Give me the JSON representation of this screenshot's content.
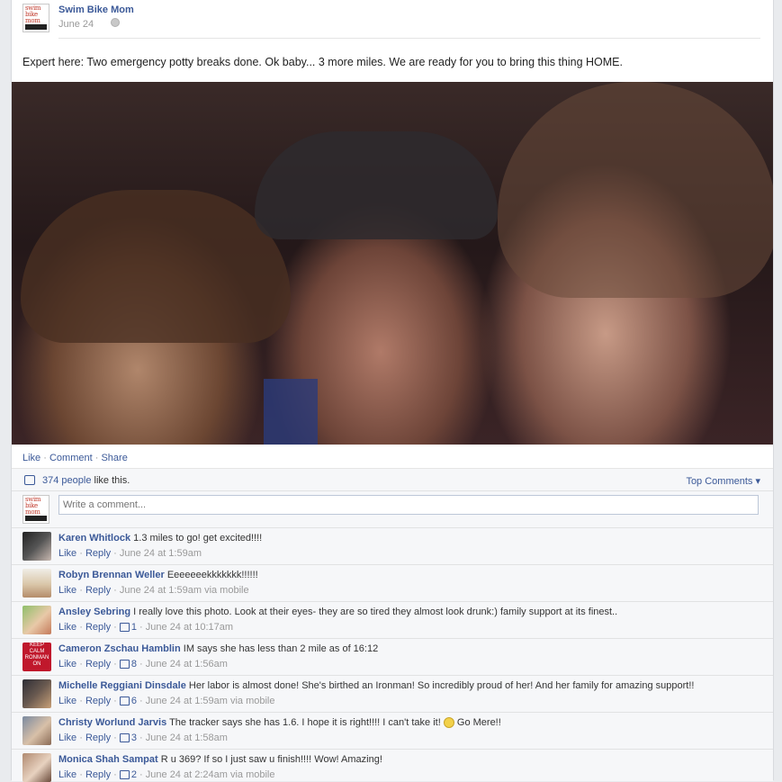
{
  "post": {
    "author": "Swim Bike Mom",
    "date": "June 24",
    "message": "Expert here: Two emergency potty breaks done. Ok baby... 3 more miles. We are ready for you to bring this thing HOME.",
    "logo_text": "swim bike mom"
  },
  "actions": {
    "like": "Like",
    "comment": "Comment",
    "share": "Share",
    "sep": "·"
  },
  "likes": {
    "count_text": "374 people",
    "suffix": " like this.",
    "top_comments": "Top Comments ▾"
  },
  "composer": {
    "placeholder": "Write a comment..."
  },
  "comments": [
    {
      "name": "Karen Whitlock",
      "text": "1.3 miles to go! get excited!!!!",
      "likes": "",
      "time": "June 24 at 1:59am",
      "via": ""
    },
    {
      "name": "Robyn Brennan Weller",
      "text": "Eeeeeeekkkkkkk!!!!!!",
      "likes": "",
      "time": "June 24 at 1:59am",
      "via": "via mobile"
    },
    {
      "name": "Ansley Sebring",
      "text": "I really love this photo. Look at their eyes- they are so tired they almost look drunk:) family support at its finest..",
      "likes": "1",
      "time": "June 24 at 10:17am",
      "via": ""
    },
    {
      "name": "Cameron Zschau Hamblin",
      "text": "IM says she has less than 2 mile as of 16:12",
      "likes": "8",
      "time": "June 24 at 1:56am",
      "via": ""
    },
    {
      "name": "Michelle Reggiani Dinsdale",
      "text": "Her labor is almost done! She's birthed an Ironman! So incredibly proud of her! And her family for amazing support!!",
      "likes": "6",
      "time": "June 24 at 1:59am",
      "via": "via mobile"
    },
    {
      "name": "Christy Worlund Jarvis",
      "text": "The tracker says she has 1.6. I hope it is right!!!! I can't take it!",
      "text2": "Go Mere!!",
      "likes": "3",
      "time": "June 24 at 1:58am",
      "via": ""
    },
    {
      "name": "Monica Shah Sampat",
      "text": "R u 369? If so I just saw u finish!!!! Wow! Amazing!",
      "likes": "2",
      "time": "June 24 at 2:24am",
      "via": "via mobile"
    }
  ],
  "meta": {
    "like": "Like",
    "reply": "Reply"
  },
  "avatar_label": "KEEP CALM RONMAN ON",
  "colors": {
    "link": "#3b5998",
    "muted": "#999999",
    "panel": "#f6f7f9"
  }
}
